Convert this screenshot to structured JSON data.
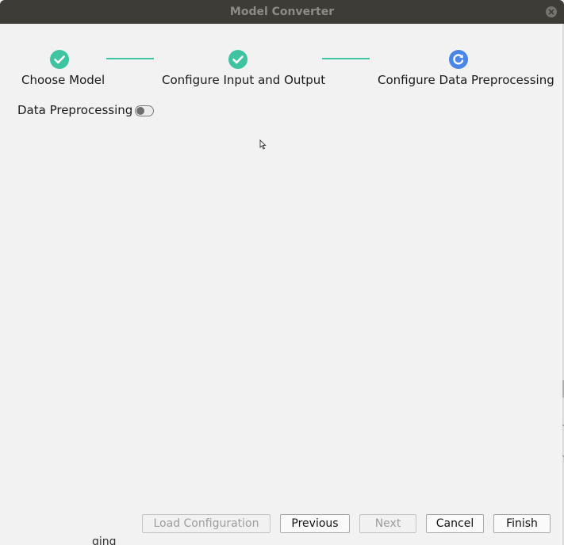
{
  "window": {
    "title": "Model Converter"
  },
  "steps": [
    {
      "label": "Choose Model",
      "status": "complete",
      "icon": "check-circle-icon"
    },
    {
      "label": "Configure Input and Output",
      "status": "complete",
      "icon": "check-circle-icon"
    },
    {
      "label": "Configure Data Preprocessing",
      "status": "in-progress",
      "icon": "refresh-circle-icon"
    }
  ],
  "preprocessing": {
    "label": "Data Preprocessing",
    "enabled": false
  },
  "buttons": {
    "load_configuration": "Load Configuration",
    "previous": "Previous",
    "next": "Next",
    "cancel": "Cancel",
    "finish": "Finish"
  },
  "background_window": {
    "partial_text": "ging"
  },
  "colors": {
    "complete": "#3ec4a1",
    "active": "#4a86e8",
    "titlebar": "#3e3c37"
  }
}
